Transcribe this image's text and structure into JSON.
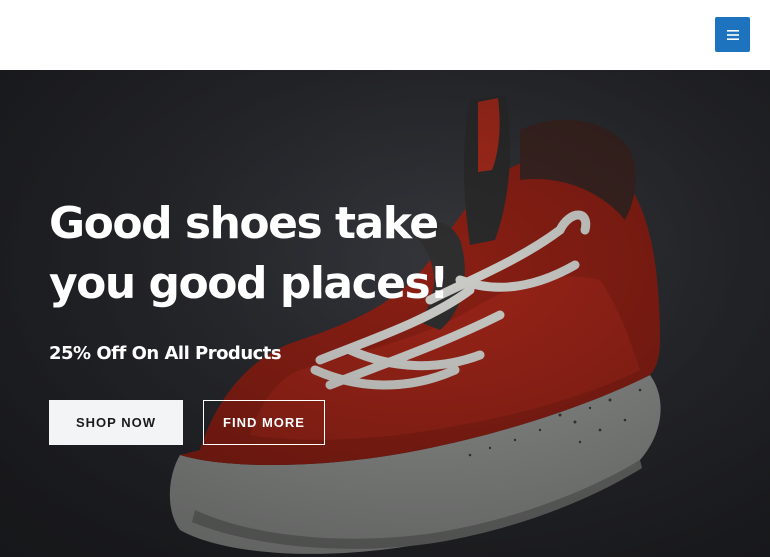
{
  "header": {
    "menu_icon": "hamburger-menu-icon",
    "menu_color": "#1e73be"
  },
  "hero": {
    "title_line1": "Good shoes take",
    "title_line2": "you good places!",
    "subtitle": "25% Off On All Products",
    "primary_button": "SHOP NOW",
    "secondary_button": "FIND MORE",
    "image": "red-basketball-sneaker-photo"
  }
}
